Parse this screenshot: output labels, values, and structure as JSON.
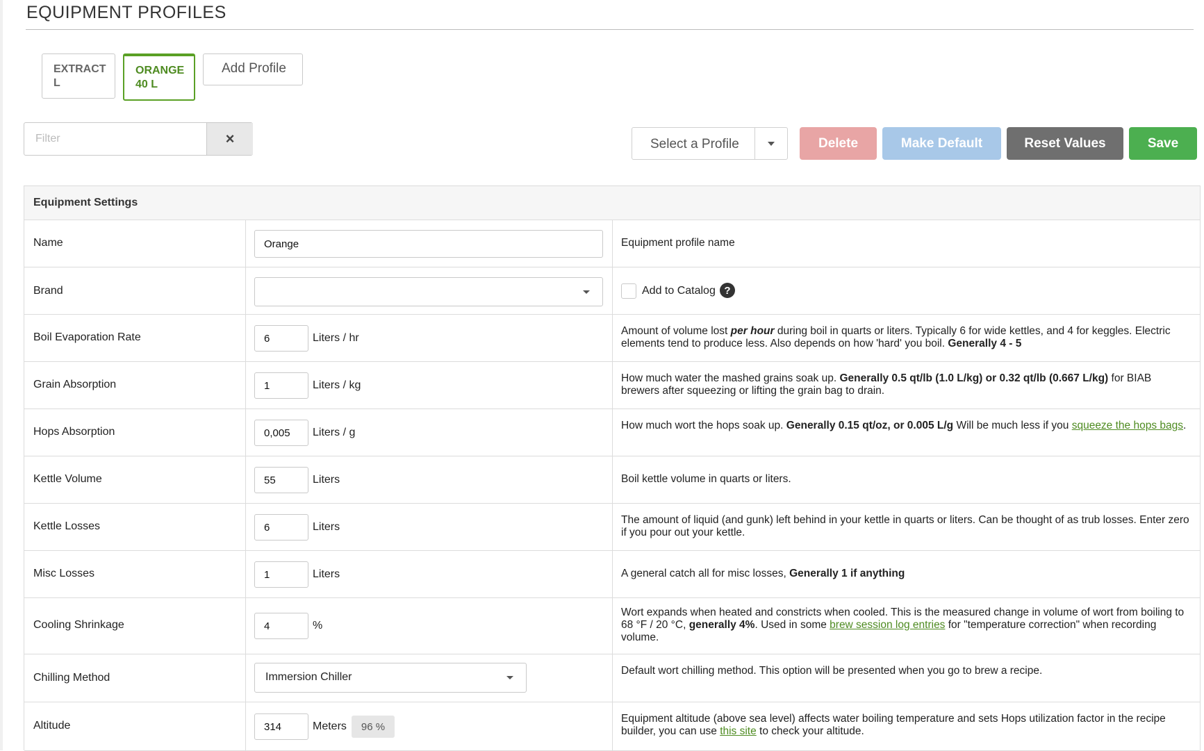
{
  "page": {
    "title": "EQUIPMENT PROFILES"
  },
  "profile_tabs": [
    {
      "line1": "EXTRACT",
      "line2": "L",
      "active": false
    },
    {
      "line1": "ORANGE",
      "line2": "40 L",
      "active": true
    },
    {
      "label": "Add Profile"
    }
  ],
  "filter": {
    "placeholder": "Filter",
    "clear_icon": "×"
  },
  "toolbar": {
    "select_profile": "Select a Profile",
    "delete": "Delete",
    "make_default": "Make Default",
    "reset_values": "Reset Values",
    "save": "Save"
  },
  "colors": {
    "accent_green": "#4caf50",
    "active_tab": "#5aa025",
    "delete_disabled": "#e8a5a5",
    "default_disabled": "#a8c8e8",
    "reset": "#6f6f6f",
    "link": "#4e8b21"
  },
  "settings": {
    "header": "Equipment Settings",
    "name": {
      "label": "Name",
      "value": "Orange",
      "desc": "Equipment profile name"
    },
    "brand": {
      "label": "Brand",
      "value": "",
      "catalog_label": "Add to Catalog",
      "help_icon": "?"
    },
    "boil_evap": {
      "label": "Boil Evaporation Rate",
      "value": "6",
      "unit": "Liters / hr",
      "d1": "Amount of volume lost ",
      "d2": "per hour",
      "d3": " during boil in quarts or liters. Typically 6 for wide kettles, and 4 for keggles. Electric elements tend to produce less. Also depends on how 'hard' you boil. ",
      "d4": "Generally 4 - 5"
    },
    "grain_abs": {
      "label": "Grain Absorption",
      "value": "1",
      "unit": "Liters / kg",
      "d1": "How much water the mashed grains soak up. ",
      "d2": "Generally 0.5 qt/lb (1.0 L/kg) or 0.32 qt/lb (0.667 L/kg)",
      "d3": " for BIAB brewers after squeezing or lifting the grain bag to drain."
    },
    "hops_abs": {
      "label": "Hops Absorption",
      "value": "0,005",
      "unit": "Liters / g",
      "d1": "How much wort the hops soak up. ",
      "d2": "Generally 0.15 qt/oz, or 0.005 L/g",
      "d3": " Will be much less if you ",
      "link": "squeeze the hops bags",
      "d4": "."
    },
    "kettle_vol": {
      "label": "Kettle Volume",
      "value": "55",
      "unit": "Liters",
      "desc": "Boil kettle volume in quarts or liters."
    },
    "kettle_loss": {
      "label": "Kettle Losses",
      "value": "6",
      "unit": "Liters",
      "desc": "The amount of liquid (and gunk) left behind in your kettle in quarts or liters. Can be thought of as trub losses. Enter zero if you pour out your kettle."
    },
    "misc_loss": {
      "label": "Misc Losses",
      "value": "1",
      "unit": "Liters",
      "d1": "A general catch all for misc losses, ",
      "d2": "Generally 1 if anything"
    },
    "cooling": {
      "label": "Cooling Shrinkage",
      "value": "4",
      "unit": "%",
      "d1": "Wort expands when heated and constricts when cooled. This is the measured change in volume of wort from boiling to 68 °F / 20 °C, ",
      "d2": "generally 4%",
      "d3": ". Used in some ",
      "link": "brew session log entries",
      "d4": " for \"temperature correction\" when recording volume."
    },
    "chilling": {
      "label": "Chilling Method",
      "value": "Immersion Chiller",
      "desc": "Default wort chilling method. This option will be presented when you go to brew a recipe."
    },
    "altitude": {
      "label": "Altitude",
      "value": "314",
      "unit": "Meters",
      "badge": "96 %",
      "d1": "Equipment altitude (above sea level) affects water boiling temperature and sets Hops utilization factor in the recipe builder, you can use ",
      "link": "this site",
      "d2": " to check your altitude."
    }
  }
}
